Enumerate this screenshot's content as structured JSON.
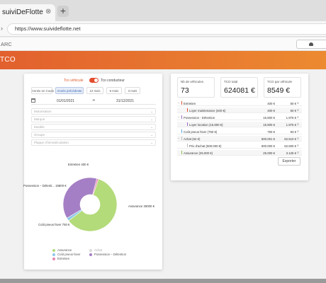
{
  "browser": {
    "tab_title": "suiviDeFlotte",
    "tab_close": "⊗",
    "new_tab": "+",
    "url": "https://www.suivideflotte.net",
    "bookmark": "ARC"
  },
  "page": {
    "title": "TCO"
  },
  "filters": {
    "toggle_left": "Tco véhicule",
    "toggle_right": "Tco conducteur",
    "toggle_on": true,
    "periods": [
      {
        "label": "Année en Cours",
        "active": false
      },
      {
        "label": "Année précédente",
        "active": true
      },
      {
        "label": "12 mois",
        "active": false
      },
      {
        "label": "6 mois",
        "active": false
      },
      {
        "label": "3 mois",
        "active": false
      }
    ],
    "date_from": "01/01/2021",
    "date_to": "31/12/2021",
    "selects": [
      "Motorisation",
      "Marque",
      "Modèle",
      "Groupe",
      "Plaque d'immatriculation"
    ]
  },
  "chart_data": {
    "type": "pie",
    "donut": true,
    "slices": [
      {
        "label": "Assurance 25000 €",
        "name": "Assurance",
        "value": 25000,
        "color": "#b3db7a"
      },
      {
        "label": "Achat",
        "name": "Achat",
        "value": 0,
        "color": "#d9d9d9"
      },
      {
        "label": "Coût pneus hiver 750 €",
        "name": "Coût pneus hiver",
        "value": 750,
        "color": "#8ec8e8"
      },
      {
        "label": "Possession – Détenti... 15800 €",
        "name": "Possession – Détention",
        "value": 15800,
        "color": "#a57fc5"
      },
      {
        "label": "Entretien 400 €",
        "name": "Entretien",
        "value": 400,
        "color": "#e886b1"
      }
    ]
  },
  "kpis": [
    {
      "label": "Nb de véhicules",
      "value": "73"
    },
    {
      "label": "TCO total",
      "value": "624081 €"
    },
    {
      "label": "TCO par véhicule",
      "value": "8549 €"
    }
  ],
  "table": {
    "rows": [
      {
        "label": "Entretien",
        "v1": "400 €",
        "v2": "50 €",
        "level": 0,
        "expand": "−",
        "bar": "#e34d2e"
      },
      {
        "label": "Loyer maintenance (400 €)",
        "v1": "400 €",
        "v2": "50 €",
        "level": 1,
        "bar": "#e34d2e"
      },
      {
        "label": "Possession - Détention",
        "v1": "15.800 €",
        "v2": "1.975 €",
        "level": 0,
        "expand": "−",
        "bar": "#9b6bc4"
      },
      {
        "label": "Loyer location (15.800 €)",
        "v1": "15.800 €",
        "v2": "1.975 €",
        "level": 1,
        "bar": "#9b6bc4"
      },
      {
        "label": "Coût pneus hiver (750 €)",
        "v1": "750 €",
        "v2": "93 €",
        "level": 0,
        "bar": "#5aa9d6"
      },
      {
        "label": "Achat (62 €)",
        "v1": "500.001 €",
        "v2": "62.510 €",
        "level": 0,
        "expand": "−",
        "bar": "#bbbbbb"
      },
      {
        "label": "Prix d'achat (500.000 €)",
        "v1": "500.000 €",
        "v2": "62.500 €",
        "level": 1,
        "bar": "#bbbbbb"
      },
      {
        "label": "Assurance (25.000 €)",
        "v1": "25.000 €",
        "v2": "3.125 €",
        "level": 0,
        "bar": "#8cc152"
      }
    ],
    "row_icon": "≡",
    "export_label": "Exporter"
  }
}
